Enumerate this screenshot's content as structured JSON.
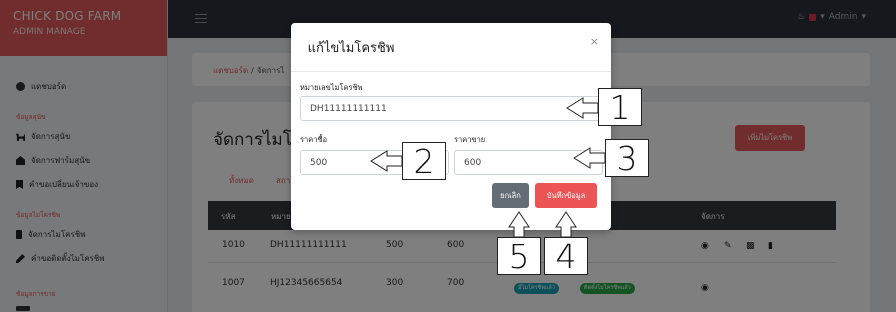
{
  "app": {
    "brand": "CHICK DOG FARM",
    "subtitle": "ADMIN MANAGE"
  },
  "sidebar": {
    "dashboard": "แดชบอร์ด",
    "sections": [
      {
        "title": "ข้อมูลสุนัข",
        "items": [
          "จัดการสุนัข",
          "จัดการฟาร์มสุนัข",
          "คำขอเปลี่ยนเจ้าของ"
        ]
      },
      {
        "title": "ข้อมูลไมโครชิพ",
        "items": [
          "จัดการไมโครชิพ",
          "คำขอติดตั้งไมโครชิพ"
        ]
      },
      {
        "title": "ข้อมูลการขาย",
        "items": []
      }
    ]
  },
  "topbar": {
    "user": "Admin",
    "caret": "▾"
  },
  "breadcrumb": {
    "home": "แดชบอร์ด",
    "separator": "/",
    "current": "จัดการไ"
  },
  "page": {
    "title": "จัดการไมโ",
    "add_button": "เพิ่มไมโครชิพ",
    "tabs": [
      "ทั้งหมด",
      "สถา"
    ]
  },
  "table": {
    "headers": [
      "รหัส",
      "หมาย",
      "จัดการ"
    ],
    "rows": [
      {
        "id": "1010",
        "number": "DH11111111111",
        "buy": "500",
        "sell": "600",
        "badges": []
      },
      {
        "id": "1007",
        "number": "HJ12345665654",
        "buy": "300",
        "sell": "700",
        "badges": [
          "มีไมโครชิพแล้ว",
          "ติดตั้งไมโครชิพแล้ว"
        ]
      }
    ]
  },
  "modal": {
    "title": "แก้ไขไมโครชิพ",
    "close": "×",
    "number_label": "หมายเลขไมโครชิพ",
    "number_value": "DH11111111111",
    "buy_label": "ราคาซื้อ",
    "buy_value": "500",
    "sell_label": "ราคาขาย",
    "sell_value": "600",
    "cancel_label": "ยกเลิก",
    "save_label": "บันทึกข้อมูล"
  },
  "callouts": [
    "1",
    "2",
    "3",
    "4",
    "5"
  ],
  "colors": {
    "brand": "#e2585a",
    "topbar": "#2b333b",
    "cancel": "#646c75",
    "save": "#ec5456"
  }
}
